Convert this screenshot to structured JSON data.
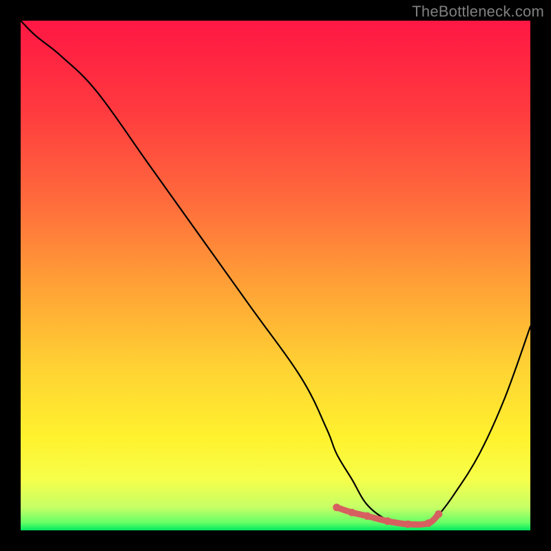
{
  "watermark": "TheBottleneck.com",
  "chart_data": {
    "type": "line",
    "title": "",
    "xlabel": "",
    "ylabel": "",
    "xlim": [
      0,
      100
    ],
    "ylim": [
      0,
      100
    ],
    "series": [
      {
        "name": "curve",
        "x": [
          0,
          3,
          8,
          15,
          25,
          35,
          45,
          55,
          60,
          62,
          65,
          68,
          72,
          76,
          80,
          82,
          85,
          90,
          95,
          100
        ],
        "y": [
          100,
          97,
          93,
          86,
          72,
          58,
          44,
          30,
          20,
          15,
          10,
          5,
          2,
          1,
          1,
          3,
          7,
          15,
          26,
          40
        ]
      }
    ],
    "highlight": {
      "name": "min-plateau",
      "x": [
        62,
        65,
        68,
        72,
        76,
        80,
        82
      ],
      "y": [
        4.5,
        3.5,
        2.8,
        1.8,
        1.2,
        1.4,
        3.2
      ]
    },
    "gradient_stops": [
      {
        "offset": 0.0,
        "color": "#ff1744"
      },
      {
        "offset": 0.18,
        "color": "#ff3b3f"
      },
      {
        "offset": 0.35,
        "color": "#ff6a3c"
      },
      {
        "offset": 0.52,
        "color": "#ffa136"
      },
      {
        "offset": 0.68,
        "color": "#ffd233"
      },
      {
        "offset": 0.82,
        "color": "#fff22e"
      },
      {
        "offset": 0.9,
        "color": "#f6ff4a"
      },
      {
        "offset": 0.955,
        "color": "#c6ff66"
      },
      {
        "offset": 0.985,
        "color": "#66ff66"
      },
      {
        "offset": 1.0,
        "color": "#00e860"
      }
    ]
  }
}
